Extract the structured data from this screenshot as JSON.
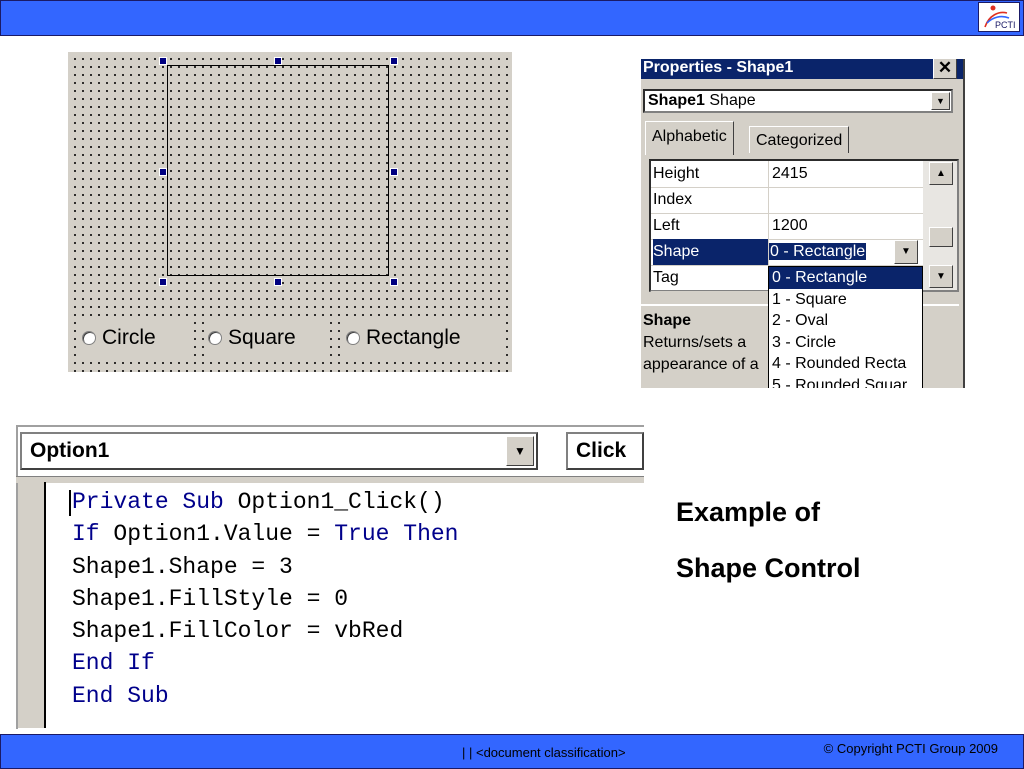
{
  "header": {
    "logo_text": "PCTI"
  },
  "designer": {
    "options": [
      {
        "label": "Circle"
      },
      {
        "label": "Square"
      },
      {
        "label": "Rectangle"
      }
    ]
  },
  "properties": {
    "title": "Properties - Shape1",
    "close_glyph": "✕",
    "object_name": "Shape1",
    "object_type": "Shape",
    "tabs": [
      "Alphabetic",
      "Categorized"
    ],
    "rows": [
      {
        "name": "Height",
        "value": "2415"
      },
      {
        "name": "Index",
        "value": ""
      },
      {
        "name": "Left",
        "value": "1200"
      },
      {
        "name": "Shape",
        "value": "0 - Rectangle"
      },
      {
        "name": "Tag",
        "value": ""
      }
    ],
    "dropdown_options": [
      "0 - Rectangle",
      "1 - Square",
      "2 - Oval",
      "3 - Circle",
      "4 - Rounded Recta",
      "5 - Rounded Squar"
    ],
    "description_title": "Shape",
    "description_line1": "Returns/sets a ",
    "description_line2": "appearance of a"
  },
  "code_editor": {
    "object_combo": "Option1",
    "event_combo": "Click",
    "lines": [
      {
        "kw1": "Private Sub",
        "text": " Option1_Click()"
      },
      {
        "kw1": "If",
        "text": " Option1.Value = ",
        "kw2": "True Then"
      },
      {
        "text": "Shape1.Shape = 3"
      },
      {
        "text": "Shape1.FillStyle = 0"
      },
      {
        "text": "Shape1.FillColor = vbRed"
      },
      {
        "kw1": "End If"
      },
      {
        "kw1": "End Sub"
      }
    ]
  },
  "caption": {
    "line1": "Example of",
    "line2": "Shape Control"
  },
  "footer": {
    "classification": "|   | <document classification>",
    "copyright": "© Copyright  PCTI Group 2009"
  },
  "colors": {
    "bar": "#3366ff",
    "selection": "#0a246a",
    "keyword": "#00008b"
  }
}
